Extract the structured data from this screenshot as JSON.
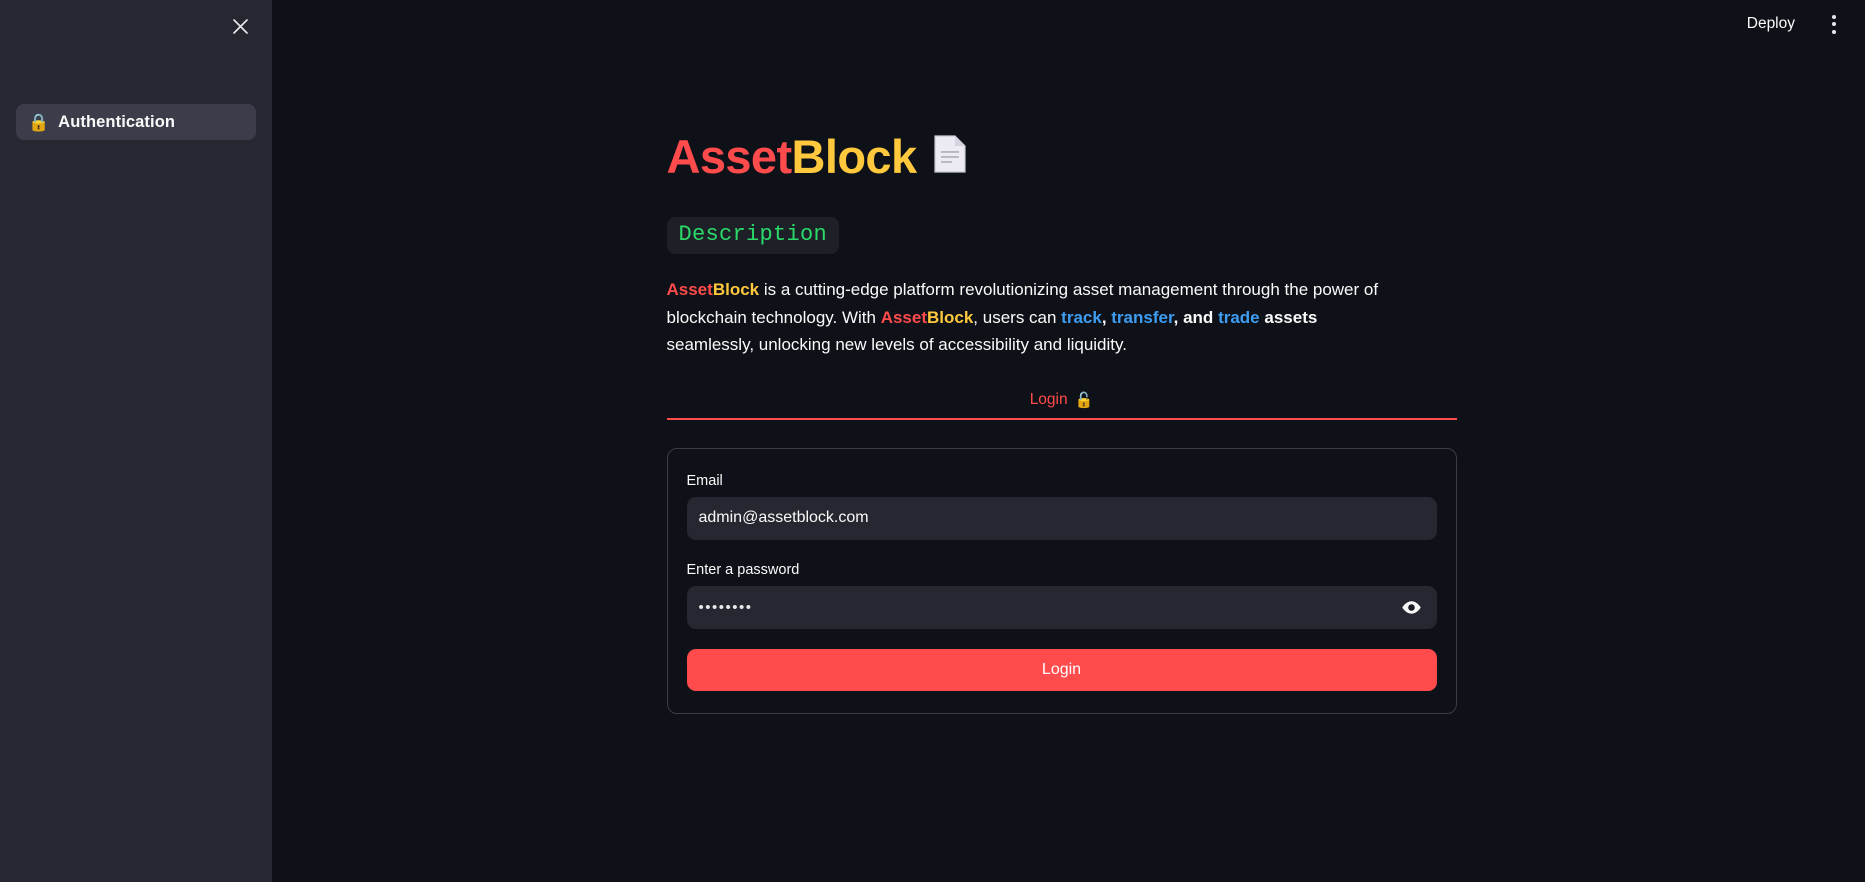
{
  "theme": {
    "background": "#0e1117",
    "sidebar_background": "#262730",
    "accent_red": "#ff4b4b",
    "accent_amber": "#ffc83d",
    "accent_blue": "#3d9df3",
    "accent_green": "#2bd96a",
    "input_background": "#262730",
    "text": "#fafafa"
  },
  "sidebar": {
    "close_icon": "close-icon",
    "items": [
      {
        "emoji": "🔒",
        "label": "Authentication",
        "icon_name": "lock-icon",
        "selected": true
      }
    ]
  },
  "topbar": {
    "deploy_label": "Deploy",
    "menu_icon": "three-dots-vertical-icon"
  },
  "hero": {
    "title_part1": "Asset",
    "title_part2": "Block",
    "icon_name": "document-icon"
  },
  "description": {
    "badge": "Description",
    "paragraph": {
      "brand_red": "Asset",
      "brand_amber": "Block",
      "s1": " is a cutting-edge platform revolutionizing asset management through the power of blockchain technology. With ",
      "brand2_red": "Asset",
      "brand2_amber": "Block",
      "s2": ", users can ",
      "kw_track": "track",
      "sep1": ", ",
      "kw_transfer": "transfer",
      "sep2": ", ",
      "kw_and": "and",
      "sep3": " ",
      "kw_trade": "trade",
      "sep4": " ",
      "kw_assets": "assets",
      "s3": " seamlessly, unlocking new levels of accessibility and liquidity."
    }
  },
  "tabs": [
    {
      "label": "Login",
      "emoji": "🔓",
      "icon_name": "unlocked-padlock-icon",
      "active": true
    }
  ],
  "form": {
    "email_label": "Email",
    "email_value": "admin@assetblock.com",
    "email_placeholder": "",
    "password_label": "Enter a password",
    "password_value": "••••••••",
    "password_placeholder": "",
    "password_toggle_icon": "eye-icon",
    "submit_label": "Login"
  }
}
